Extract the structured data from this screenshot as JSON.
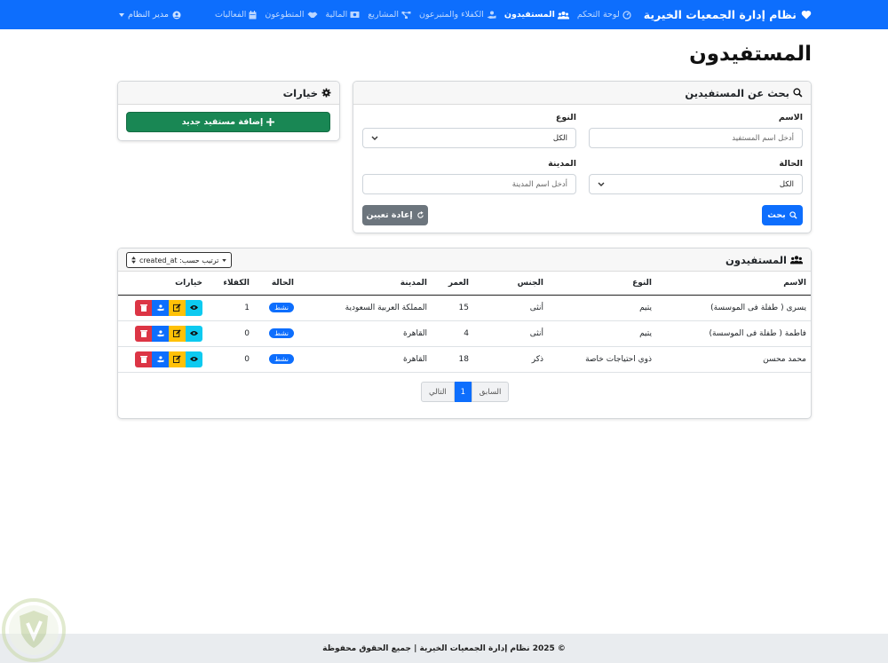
{
  "navbar": {
    "brand": "نظام إدارة الجمعيات الخيرية",
    "items": [
      {
        "label": "لوحة التحكم",
        "active": false,
        "icon": "dashboard-icon"
      },
      {
        "label": "المستفيدون",
        "active": true,
        "icon": "users-icon"
      },
      {
        "label": "الكفلاء والمتبرعون",
        "active": false,
        "icon": "hand-holding-icon"
      },
      {
        "label": "المشاريع",
        "active": false,
        "icon": "project-diagram-icon"
      },
      {
        "label": "المالية",
        "active": false,
        "icon": "money-icon"
      },
      {
        "label": "المتطوعون",
        "active": false,
        "icon": "handshake-icon"
      },
      {
        "label": "الفعاليات",
        "active": false,
        "icon": "calendar-icon"
      }
    ],
    "user": "مدير النظام"
  },
  "page": {
    "title": "المستفيدون"
  },
  "search": {
    "header": "بحث عن المستفيدين",
    "name_label": "الاسم",
    "name_placeholder": "أدخل اسم المستفيد",
    "type_label": "النوع",
    "type_value": "الكل",
    "status_label": "الحالة",
    "status_value": "الكل",
    "city_label": "المدينة",
    "city_placeholder": "أدخل اسم المدينة",
    "search_button": "بحث",
    "reset_button": "إعادة تعيين"
  },
  "options": {
    "header": "خيارات",
    "add_button": "إضافة مستفيد جديد"
  },
  "list": {
    "header": "المستفيدون",
    "sort_label": "ترتيب حسب: created_at",
    "columns": [
      "الاسم",
      "النوع",
      "الجنس",
      "العمر",
      "المدينة",
      "الحالة",
      "الكفلاء",
      "خيارات"
    ],
    "rows": [
      {
        "name": "يسرى ( طفلة فى الموسسة)",
        "type": "يتيم",
        "gender": "أنثى",
        "age": "15",
        "city": "المملكة العربية السعودية",
        "status": "نشط",
        "sponsors": "1"
      },
      {
        "name": "فاطمة ( طفلة فى الموسسة)",
        "type": "يتيم",
        "gender": "أنثى",
        "age": "4",
        "city": "القاهرة",
        "status": "نشط",
        "sponsors": "0"
      },
      {
        "name": "محمد محسن",
        "type": "ذوي احتياجات خاصة",
        "gender": "ذكر",
        "age": "18",
        "city": "القاهرة",
        "status": "نشط",
        "sponsors": "0"
      }
    ],
    "pagination": {
      "prev": "السابق",
      "current": "1",
      "next": "التالي"
    }
  },
  "footer": {
    "text": "© 2025 نظام إدارة الجمعيات الخيرية | جميع الحقوق محفوظة"
  },
  "colors": {
    "primary": "#0d6efd",
    "success": "#198754",
    "danger": "#dc3545",
    "warning": "#ffc107",
    "info": "#0dcaf0",
    "secondary": "#6c757d"
  }
}
